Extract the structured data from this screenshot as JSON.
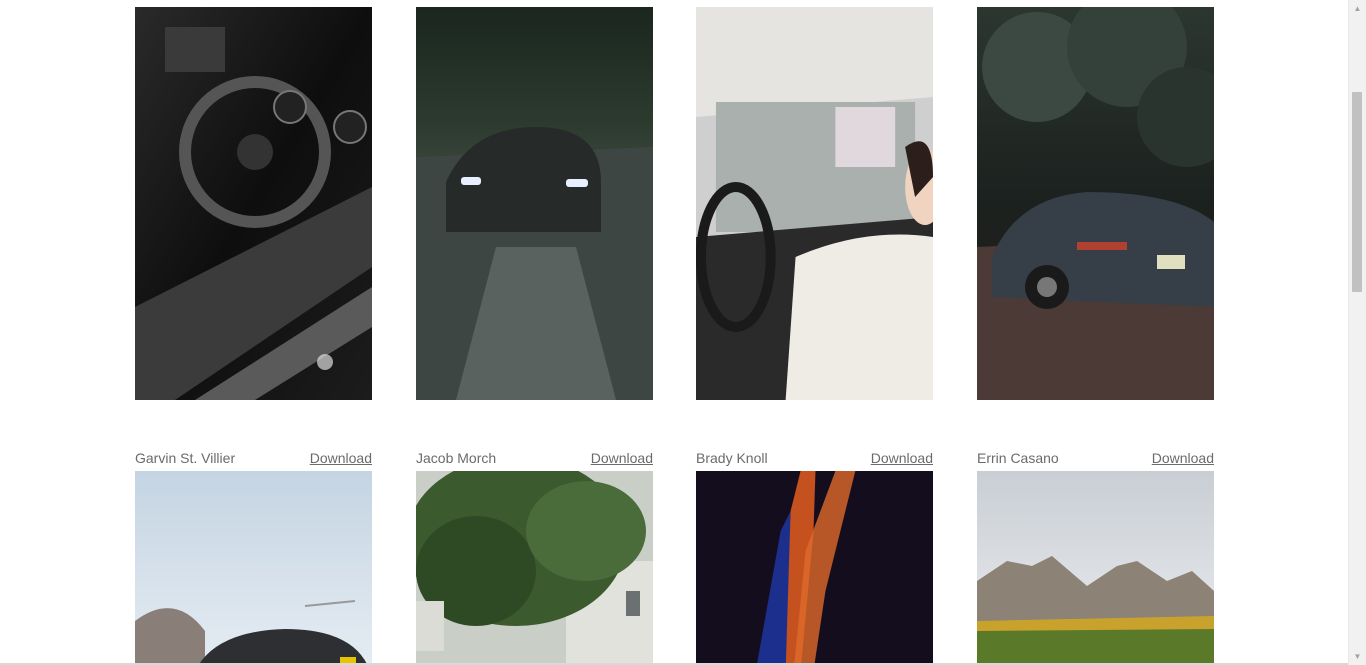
{
  "gallery": {
    "row1": [
      {
        "author": "Garvin St. Villier",
        "download_label": "Download",
        "image": "car-interior-steering-wheel"
      },
      {
        "author": "Jacob Morch",
        "download_label": "Download",
        "image": "sports-car-on-road"
      },
      {
        "author": "Brady Knoll",
        "download_label": "Download",
        "image": "woman-driving-car"
      },
      {
        "author": "Errin Casano",
        "download_label": "Download",
        "image": "dark-sports-car-parked"
      }
    ],
    "row2": [
      {
        "image": "car-under-sky"
      },
      {
        "image": "tree-and-building"
      },
      {
        "image": "car-door-abstract"
      },
      {
        "image": "mountain-landscape"
      }
    ]
  },
  "scrollbar": {
    "up_icon": "triangle-up-icon",
    "down_icon": "triangle-down-icon"
  }
}
